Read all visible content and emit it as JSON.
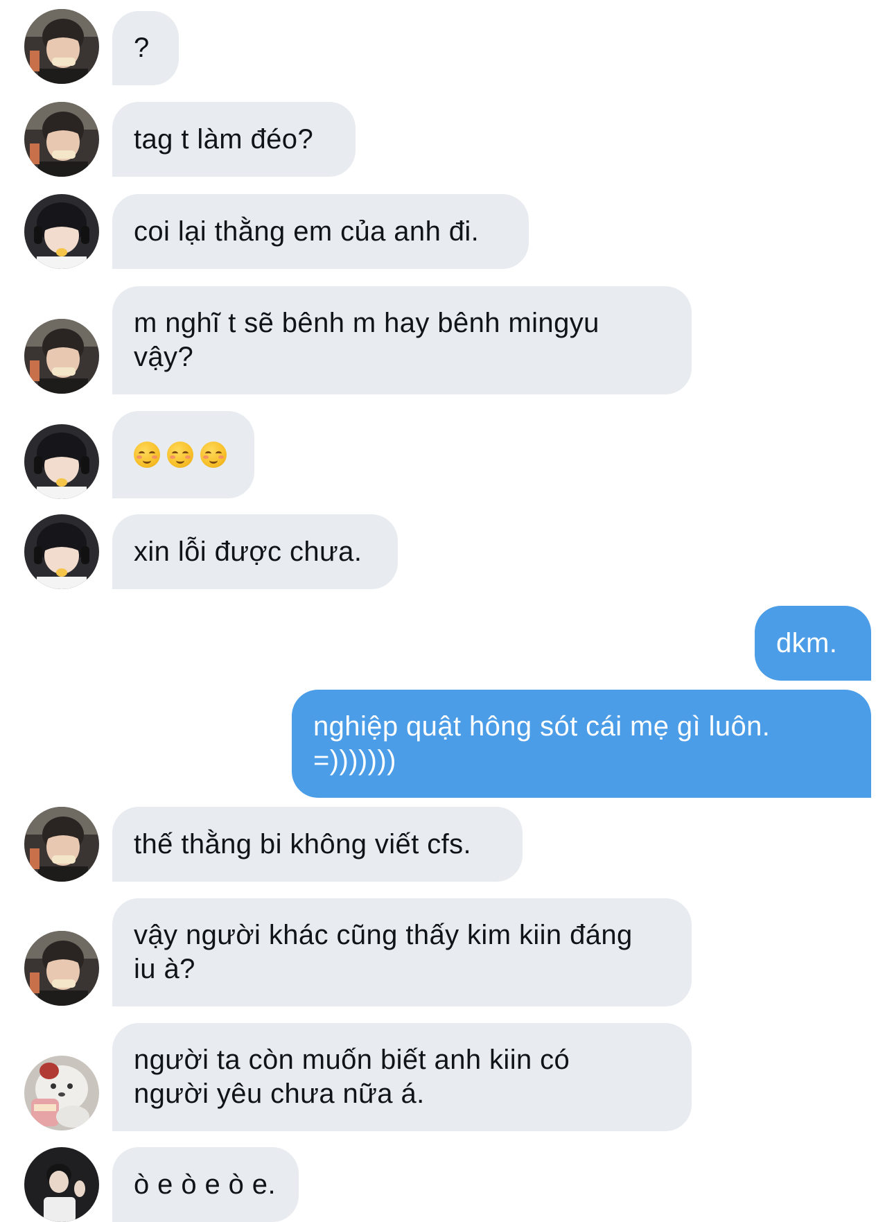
{
  "conversation": {
    "messages": [
      {
        "sender": "avatar-a",
        "direction": "in",
        "text": "?"
      },
      {
        "sender": "avatar-a",
        "direction": "in",
        "text": "tag t làm đéo?"
      },
      {
        "sender": "avatar-b",
        "direction": "in",
        "text": "coi lại thằng em của anh đi."
      },
      {
        "sender": "avatar-a",
        "direction": "in",
        "text": "m nghĩ t sẽ bênh m hay bênh mingyu\nvậy?"
      },
      {
        "sender": "avatar-b",
        "direction": "in",
        "text": "",
        "emoji": [
          "relieved-smile-emoji",
          "relieved-smile-emoji",
          "relieved-smile-emoji"
        ]
      },
      {
        "sender": "avatar-b",
        "direction": "in",
        "text": "xin lỗi được chưa."
      },
      {
        "sender": "me",
        "direction": "out",
        "text": "dkm."
      },
      {
        "sender": "me",
        "direction": "out",
        "text": "nghiệp quật hông sót cái mẹ gì luôn.\n=)))))))"
      },
      {
        "sender": "avatar-a",
        "direction": "in",
        "text": "thế thằng bi không viết cfs."
      },
      {
        "sender": "avatar-a",
        "direction": "in",
        "text": "vậy người khác cũng thấy kim kiin đáng\niu à?"
      },
      {
        "sender": "avatar-c",
        "direction": "in",
        "text": "người ta còn muốn biết anh kiin có\nngười yêu chưa nữa á."
      },
      {
        "sender": "avatar-d",
        "direction": "in",
        "text": "ò e ò e ò e."
      }
    ]
  },
  "colors": {
    "incoming_bubble": "#e8ebef",
    "outgoing_bubble": "#4c9de8",
    "incoming_text": "#0f1419",
    "outgoing_text": "#ffffff",
    "background": "#ffffff"
  }
}
